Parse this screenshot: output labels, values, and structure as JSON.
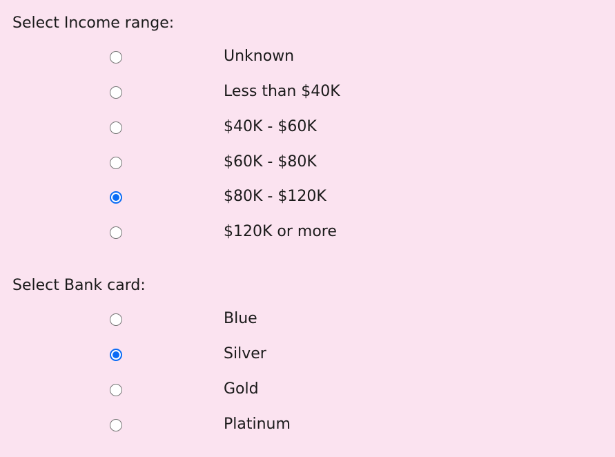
{
  "income": {
    "heading": "Select Income range:",
    "selected_index": 4,
    "options": [
      {
        "label": "Unknown",
        "checked": false
      },
      {
        "label": "Less than $40K",
        "checked": false
      },
      {
        "label": "$40K - $60K",
        "checked": false
      },
      {
        "label": "$60K - $80K",
        "checked": false
      },
      {
        "label": "$80K - $120K",
        "checked": true
      },
      {
        "label": "$120K or more",
        "checked": false
      }
    ]
  },
  "bank_card": {
    "heading": "Select Bank card:",
    "selected_index": 1,
    "options": [
      {
        "label": "Blue",
        "checked": false
      },
      {
        "label": "Silver",
        "checked": true
      },
      {
        "label": "Gold",
        "checked": false
      },
      {
        "label": "Platinum",
        "checked": false
      }
    ]
  },
  "colors": {
    "background": "#fbe3f0",
    "radio_checked": "#0a6cf5",
    "radio_border": "#767676",
    "text": "#1a1a1a"
  }
}
